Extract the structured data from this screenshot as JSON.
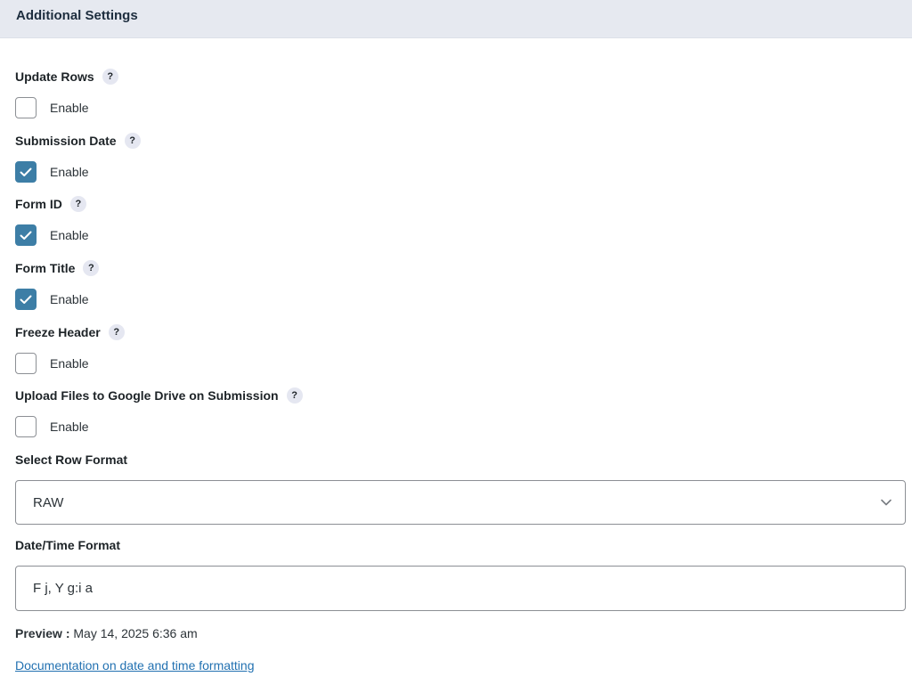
{
  "header": {
    "title": "Additional Settings"
  },
  "settings": [
    {
      "label": "Update Rows",
      "help": "?",
      "option": "Enable",
      "checked": false
    },
    {
      "label": "Submission Date",
      "help": "?",
      "option": "Enable",
      "checked": true
    },
    {
      "label": "Form ID",
      "help": "?",
      "option": "Enable",
      "checked": true
    },
    {
      "label": "Form Title",
      "help": "?",
      "option": "Enable",
      "checked": true
    },
    {
      "label": "Freeze Header",
      "help": "?",
      "option": "Enable",
      "checked": false
    },
    {
      "label": "Upload Files to Google Drive on Submission",
      "help": "?",
      "option": "Enable",
      "checked": false
    }
  ],
  "row_format": {
    "label": "Select Row Format",
    "value": "RAW"
  },
  "datetime": {
    "label": "Date/Time Format",
    "value": "F j, Y g:i a"
  },
  "preview": {
    "label": "Preview :",
    "value": " May 14, 2025 6:36 am"
  },
  "doc_link": {
    "text": "Documentation on date and time formatting"
  },
  "colors": {
    "accent": "#3d7ea6",
    "link": "#2271b1",
    "header_bg": "#e6e9f0"
  },
  "icons": {
    "help": "question-badge-icon",
    "check": "checkmark-icon",
    "select": "chevron-down-icon"
  }
}
